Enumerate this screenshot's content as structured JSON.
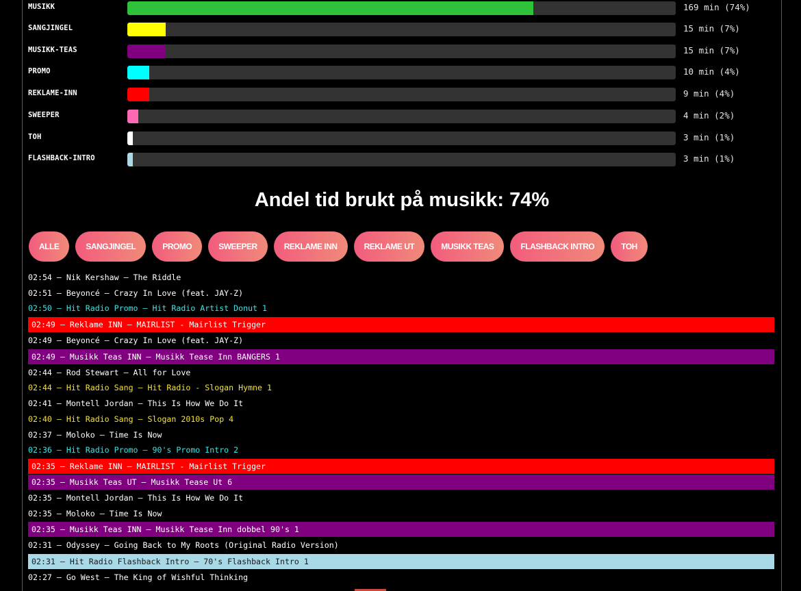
{
  "bars": [
    {
      "label": "MUSIKK",
      "value": "169 min (74%)",
      "fraction": 0.74,
      "color": "#2ec13a"
    },
    {
      "label": "SANGJINGEL",
      "value": "15 min (7%)",
      "fraction": 0.07,
      "color": "#ffff00"
    },
    {
      "label": "MUSIKK-TEAS",
      "value": "15 min (7%)",
      "fraction": 0.07,
      "color": "#800080"
    },
    {
      "label": "PROMO",
      "value": "10 min (4%)",
      "fraction": 0.04,
      "color": "#00ffff"
    },
    {
      "label": "REKLAME-INN",
      "value": "9 min (4%)",
      "fraction": 0.04,
      "color": "#ff0000"
    },
    {
      "label": "SWEEPER",
      "value": "4 min (2%)",
      "fraction": 0.02,
      "color": "#ff69b4"
    },
    {
      "label": "TOH",
      "value": "3 min (1%)",
      "fraction": 0.01,
      "color": "#ffffff"
    },
    {
      "label": "FLASHBACK-INTRO",
      "value": "3 min (1%)",
      "fraction": 0.01,
      "color": "#add8e6"
    }
  ],
  "headline": "Andel tid brukt på musikk: 74%",
  "filters": [
    "ALLE",
    "SANGJINGEL",
    "PROMO",
    "SWEEPER",
    "REKLAME INN",
    "REKLAME UT",
    "MUSIKK TEAS",
    "FLASHBACK INTRO",
    "TOH"
  ],
  "log": [
    {
      "text": "02:54 – Nik Kershaw – The Riddle",
      "style": "white"
    },
    {
      "text": "02:51 – Beyoncé – Crazy In Love (feat. JAY-Z)",
      "style": "white"
    },
    {
      "text": "02:50 – Hit Radio Promo – Hit Radio Artist Donut 1",
      "style": "cyan"
    },
    {
      "text": "02:49 – Reklame INN – MAIRLIST - Mairlist Trigger",
      "style": "red"
    },
    {
      "text": "02:49 – Beyoncé – Crazy In Love (feat. JAY-Z)",
      "style": "white"
    },
    {
      "text": "02:49 – Musikk Teas INN – Musikk Tease Inn BANGERS 1",
      "style": "purple"
    },
    {
      "text": "02:44 – Rod Stewart – All for Love",
      "style": "white"
    },
    {
      "text": "02:44 – Hit Radio Sang – Hit Radio - Slogan Hymne 1",
      "style": "yellow"
    },
    {
      "text": "02:41 – Montell Jordan – This Is How We Do It",
      "style": "white"
    },
    {
      "text": "02:40 – Hit Radio Sang – Slogan 2010s Pop 4",
      "style": "yellow"
    },
    {
      "text": "02:37 – Moloko – Time Is Now",
      "style": "white"
    },
    {
      "text": "02:36 – Hit Radio Promo – 90's Promo Intro 2",
      "style": "cyan"
    },
    {
      "text": "02:35 – Reklame INN – MAIRLIST - Mairlist Trigger",
      "style": "red"
    },
    {
      "text": "02:35 – Musikk Teas UT – Musikk Tease Ut 6",
      "style": "purple"
    },
    {
      "text": "02:35 – Montell Jordan – This Is How We Do It",
      "style": "white"
    },
    {
      "text": "02:35 – Moloko – Time Is Now",
      "style": "white"
    },
    {
      "text": "02:35 – Musikk Teas INN – Musikk Tease Inn dobbel 90's 1",
      "style": "purple"
    },
    {
      "text": "02:31 – Odyssey – Going Back to My Roots (Original Radio Version)",
      "style": "white"
    },
    {
      "text": "02:31 – Hit Radio Flashback Intro – 70's Flashback Intro 1",
      "style": "lightblue"
    },
    {
      "text": "02:27 – Go West – The King of Wishful Thinking",
      "style": "white"
    }
  ]
}
